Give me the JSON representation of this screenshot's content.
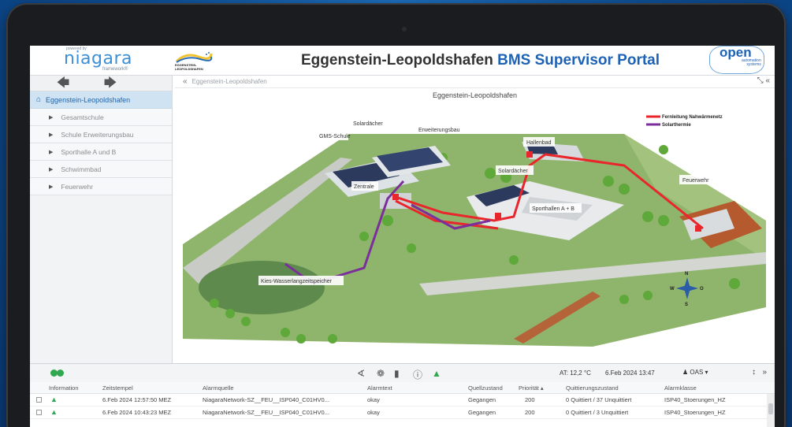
{
  "header": {
    "powered_by": "powered by",
    "niagara_logo": "niagara",
    "niagara_sub": "framework®",
    "town_logo_line1": "EGGENSTEIN-",
    "town_logo_line2": "LEOPOLDSHAFEN",
    "title_part1": "Eggenstein-Leopoldshafen ",
    "title_part2": "BMS Supervisor Portal",
    "open_logo": "open",
    "open_sub1": "automation",
    "open_sub2": "systems"
  },
  "sidebar": {
    "back_icon": "arrow-left-icon",
    "forward_icon": "arrow-right-icon",
    "root": "Eggenstein-Leopoldshafen",
    "items": [
      {
        "label": "Gesamtschule"
      },
      {
        "label": "Schule Erweiterungsbau"
      },
      {
        "label": "Sporthalle A und B"
      },
      {
        "label": "Schwimmbad"
      },
      {
        "label": "Feuerwehr"
      }
    ]
  },
  "main": {
    "breadcrumb": "Eggenstein-Leopoldshafen",
    "view_title": "Eggenstein-Leopoldshafen",
    "labels": {
      "solardaecher1": "Solardächer",
      "gms": "GMS-Schule",
      "erweiterung": "Erweiterungsbau",
      "hallenbad": "Hallenbad",
      "solardaecher2": "Solardächer",
      "zentrale": "Zentrale",
      "sporthallen": "Sporthallen A + B",
      "feuerwehr": "Feuerwehr",
      "kies": "Kies-Wasserlangzeitspeicher"
    },
    "legend": [
      {
        "label": "Fernleitung Nahwärmenetz",
        "color": "#e8262b"
      },
      {
        "label": "Solarthermie",
        "color": "#7b2f9b"
      }
    ],
    "compass": {
      "n": "N",
      "s": "S",
      "w": "W",
      "o": "O"
    }
  },
  "alarm_bar": {
    "temperature": "AT: 12,2 °C",
    "datetime": "6.Feb 2024 13:47",
    "user": "OAS ▾"
  },
  "alarm_table": {
    "headers": [
      "Information",
      "Zeitstempel",
      "Alarmquelle",
      "Alarmtext",
      "Quellzustand",
      "Priorität ▴",
      "Quittierungszustand",
      "Alarmklasse"
    ],
    "rows": [
      [
        "",
        "6.Feb 2024 12:57:50 MEZ",
        "NiagaraNetwork-SZ__FEU__ISP040_C01HV0...",
        "okay",
        "Gegangen",
        "200",
        "0 Quittiert / 37 Unquittiert",
        "ISP40_Stoerungen_HZ"
      ],
      [
        "",
        "6.Feb 2024 10:43:23 MEZ",
        "NiagaraNetwork-SZ__FEU__ISP040_C01HV0...",
        "okay",
        "Gegangen",
        "200",
        "0 Quittiert / 3 Unquittiert",
        "ISP40_Stoerungen_HZ"
      ]
    ]
  }
}
